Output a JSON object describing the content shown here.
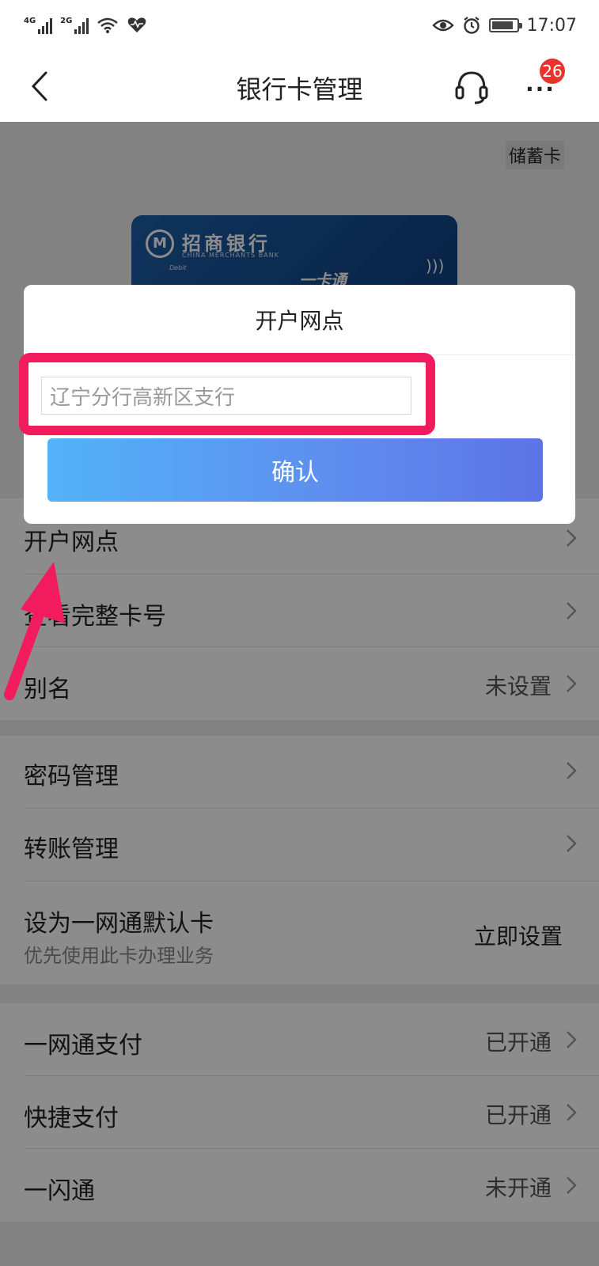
{
  "status_bar": {
    "net1": "4G",
    "net2": "2G",
    "time": "17:07",
    "battery_level": 0.85
  },
  "nav": {
    "title": "银行卡管理",
    "badge_count": "26",
    "icons": [
      "back-icon",
      "headset-icon",
      "more-icon"
    ]
  },
  "card": {
    "type_label": "储蓄卡",
    "bank_name": "招商银行",
    "bank_name_en": "CHINA MERCHANTS BANK",
    "debit": "Debit",
    "product": "一卡通"
  },
  "list": [
    {
      "label": "开户网点",
      "value": ""
    },
    {
      "label": "查看完整卡号",
      "value": ""
    },
    {
      "label": "别名",
      "value": "未设置"
    },
    {
      "label": "密码管理",
      "value": ""
    },
    {
      "label": "转账管理",
      "value": ""
    },
    {
      "label": "设为一网通默认卡",
      "sub": "优先使用此卡办理业务",
      "value": "立即设置"
    },
    {
      "label": "一网通支付",
      "value": "已开通"
    },
    {
      "label": "快捷支付",
      "value": "已开通"
    },
    {
      "label": "一闪通",
      "value": "未开通"
    }
  ],
  "dialog": {
    "title": "开户网点",
    "input_value": "辽宁分行高新区支行",
    "confirm_label": "确认"
  },
  "colors": {
    "accent_start": "#53b3f8",
    "accent_end": "#5d74e6",
    "highlight": "#f21b5e",
    "badge": "#e8332e"
  }
}
